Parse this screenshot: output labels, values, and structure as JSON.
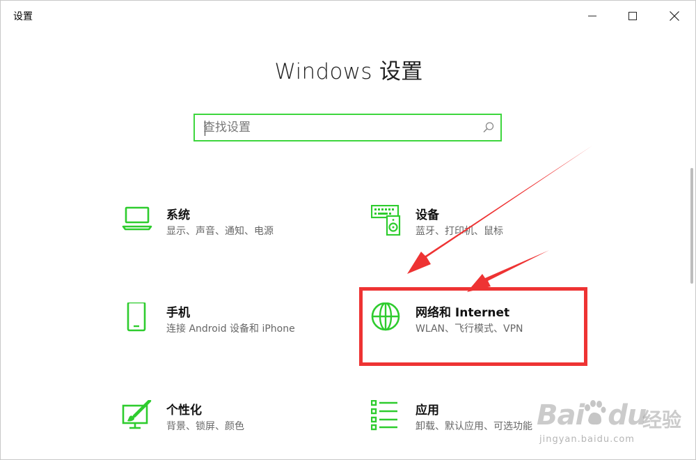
{
  "window": {
    "title": "设置"
  },
  "header": {
    "title": "Windows 设置"
  },
  "search": {
    "placeholder": "查找设置"
  },
  "tiles": [
    {
      "name": "系统",
      "desc": "显示、声音、通知、电源",
      "icon": "laptop-icon"
    },
    {
      "name": "设备",
      "desc": "蓝牙、打印机、鼠标",
      "icon": "devices-icon"
    },
    {
      "name": "手机",
      "desc": "连接 Android 设备和 iPhone",
      "icon": "phone-icon"
    },
    {
      "name": "网络和 Internet",
      "desc": "WLAN、飞行模式、VPN",
      "icon": "globe-icon"
    },
    {
      "name": "个性化",
      "desc": "背景、锁屏、颜色",
      "icon": "paint-icon"
    },
    {
      "name": "应用",
      "desc": "卸载、默认应用、可选功能",
      "icon": "apps-list-icon"
    }
  ],
  "watermark": {
    "brand": "Bai",
    "brand2": "du",
    "text": "经验",
    "url": "jingyan.baidu.com"
  },
  "colors": {
    "accent": "#2ecc2e",
    "annotation": "#ee3333",
    "search_border": "#3dd63d"
  }
}
